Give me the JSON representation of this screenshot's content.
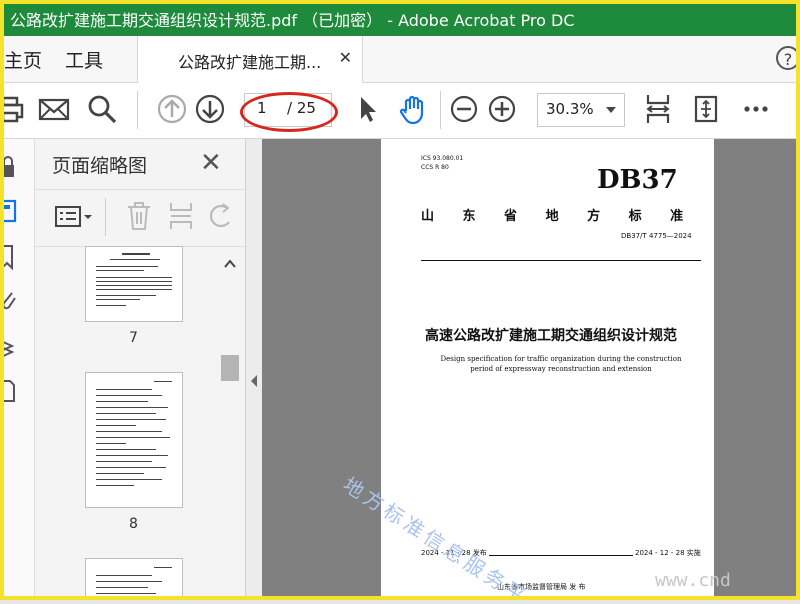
{
  "window": {
    "title": "公路改扩建施工期交通组织设计规范.pdf （已加密） - Adobe Acrobat Pro DC",
    "accent": "#1e8a3c"
  },
  "menu": {
    "home": "主页",
    "tools": "工具",
    "doc_tab": "公路改扩建施工期...",
    "help": "?"
  },
  "toolbar": {
    "page_current": "1",
    "page_total": "/ 25",
    "zoom": "30.3%",
    "icons": [
      "print-icon",
      "mail-icon",
      "search-icon",
      "prev-page-icon",
      "next-page-icon",
      "select-cursor-icon",
      "hand-tool-icon",
      "zoom-out-icon",
      "zoom-in-icon",
      "fit-width-icon",
      "fit-page-icon",
      "more-icon"
    ]
  },
  "panel": {
    "title": "页面缩略图",
    "thumbnails": [
      {
        "page": "7"
      },
      {
        "page": "8"
      }
    ]
  },
  "document": {
    "ics": "ICS  93.080.01",
    "ccs": "CCS  R 80",
    "logo": "DB37",
    "province": "山  东  省  地  方  标  准",
    "code": "DB37/T  4775—2024",
    "title_cn": "高速公路改扩建施工期交通组织设计规范",
    "title_en": "Design specification for traffic organization during the construction period of expressway reconstruction and extension",
    "watermark": "地方标准信息服务平台",
    "release_date": "2024 - 11 - 28 发布",
    "impl_date": "2024 - 12 - 28 实施",
    "publisher": "山东省市场监督管理局   发 布"
  },
  "site_watermark": "www.cnd"
}
